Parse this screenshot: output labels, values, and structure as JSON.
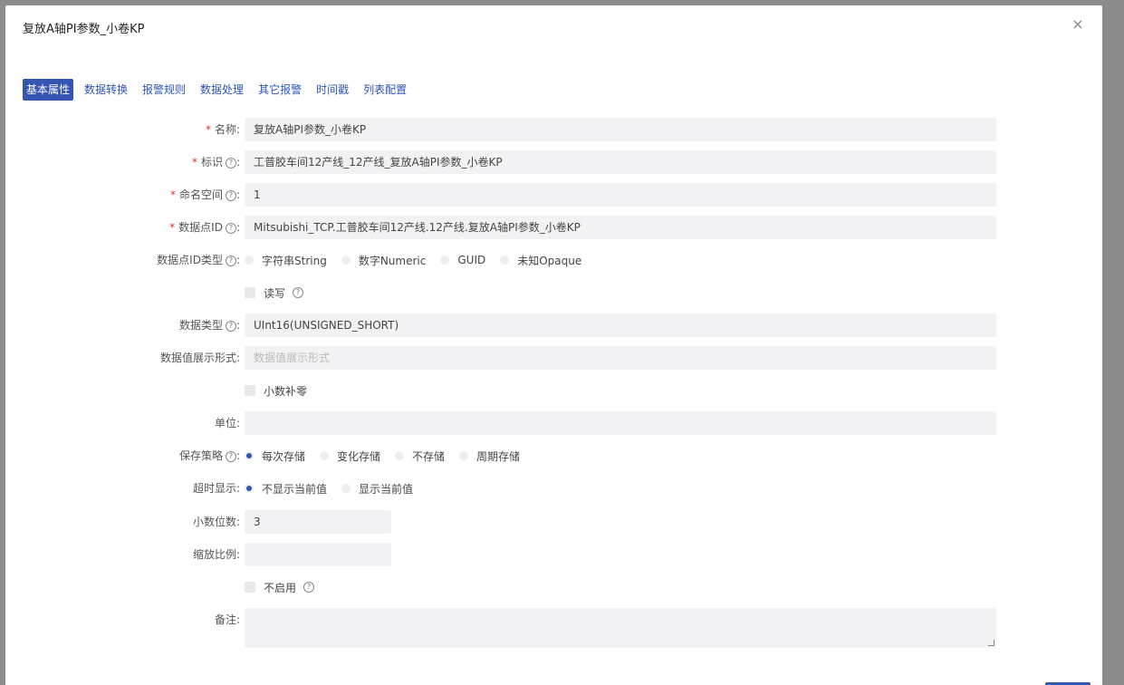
{
  "dialog": {
    "title": "复放A轴PI参数_小卷KP",
    "close": "×"
  },
  "tabs": [
    {
      "label": "基本属性",
      "active": true
    },
    {
      "label": "数据转换"
    },
    {
      "label": "报警规则"
    },
    {
      "label": "数据处理"
    },
    {
      "label": "其它报警"
    },
    {
      "label": "时间戳"
    },
    {
      "label": "列表配置"
    }
  ],
  "form": {
    "name": {
      "label": "名称:",
      "value": "复放A轴PI参数_小卷KP"
    },
    "identifier": {
      "label": "标识",
      "value": "工普胶车间12产线_12产线_复放A轴PI参数_小卷KP"
    },
    "namespace": {
      "label": "命名空间",
      "value": "1"
    },
    "datapoint_id": {
      "label": "数据点ID",
      "value": "Mitsubishi_TCP.工普胶车间12产线.12产线.复放A轴PI参数_小卷KP"
    },
    "datapoint_id_type": {
      "label": "数据点ID类型",
      "options": [
        "字符串String",
        "数字Numeric",
        "GUID",
        "未知Opaque"
      ]
    },
    "read_write": {
      "label": "读写"
    },
    "data_type": {
      "label": "数据类型",
      "value": "UInt16(UNSIGNED_SHORT)"
    },
    "display_format": {
      "label": "数据值展示形式:",
      "placeholder": "数据值展示形式"
    },
    "decimal_zero_pad": {
      "label": "小数补零"
    },
    "unit": {
      "label": "单位:",
      "value": ""
    },
    "save_strategy": {
      "label": "保存策略",
      "options": [
        "每次存储",
        "变化存储",
        "不存储",
        "周期存储"
      ],
      "selected": "每次存储"
    },
    "timeout_display": {
      "label": "超时显示:",
      "options": [
        "不显示当前值",
        "显示当前值"
      ],
      "selected": "不显示当前值"
    },
    "decimal_places": {
      "label": "小数位数:",
      "value": "3"
    },
    "scale_ratio": {
      "label": "缩放比例:",
      "value": ""
    },
    "disabled": {
      "label": "不启用"
    },
    "remark": {
      "label": "备注:",
      "value": ""
    }
  },
  "colors": {
    "accent": "#3455b2",
    "required": "#e0362b",
    "input_bg": "#f2f2f4"
  }
}
